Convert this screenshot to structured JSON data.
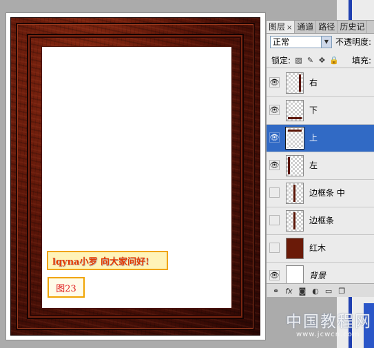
{
  "document": {
    "signature_text": "lqyna小罗 向大家问好!",
    "figure_label": "图23"
  },
  "layers_panel": {
    "tabs": [
      {
        "label": "图层",
        "active": true,
        "close": "×"
      },
      {
        "label": "通道",
        "active": false
      },
      {
        "label": "路径",
        "active": false
      },
      {
        "label": "历史记",
        "active": false
      }
    ],
    "blend_mode": "正常",
    "opacity_label": "不透明度:",
    "lock_label": "锁定:",
    "fill_label": "填充:",
    "layers": [
      {
        "name": "右",
        "visible": true,
        "selected": false,
        "thumb": "right-bar"
      },
      {
        "name": "下",
        "visible": true,
        "selected": false,
        "thumb": "bottom-bar"
      },
      {
        "name": "上",
        "visible": true,
        "selected": true,
        "thumb": "top-bar"
      },
      {
        "name": "左",
        "visible": true,
        "selected": false,
        "thumb": "left-bar"
      },
      {
        "name": "边框条 中",
        "visible": false,
        "selected": false,
        "thumb": "center-bar"
      },
      {
        "name": "边框条",
        "visible": false,
        "selected": false,
        "thumb": "center-bar"
      },
      {
        "name": "红木",
        "visible": false,
        "selected": false,
        "thumb": "solid-red"
      },
      {
        "name": "背景",
        "visible": true,
        "selected": false,
        "thumb": "plain-white",
        "italic": true
      }
    ],
    "bottom_icons": [
      "link-icon",
      "fx-icon",
      "mask-icon",
      "adjustment-icon",
      "folder-icon",
      "new-layer-icon"
    ]
  },
  "watermark": {
    "text": "中国教程网",
    "url": "www.jcwcn.com"
  },
  "colors": {
    "selected_layer": "#316ac5",
    "frame_wood": "#5a1508",
    "signature_text": "#e53a00",
    "label_border": "#f0a400"
  }
}
